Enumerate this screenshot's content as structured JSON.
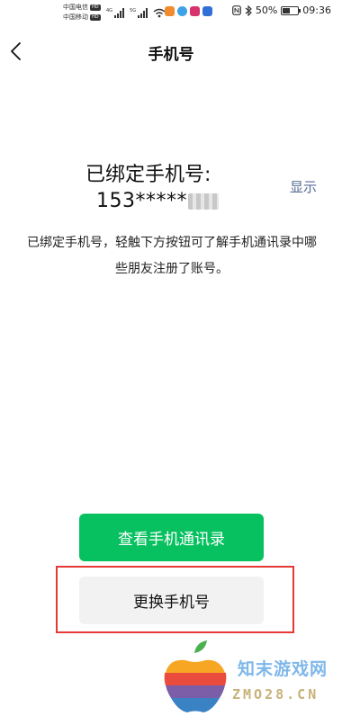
{
  "statusbar": {
    "carrier1": "中国电信",
    "carrier2": "中国移动",
    "hd": "HD",
    "sig1_label": "4G",
    "sig2_label": "5G",
    "battery_percent_text": "50%",
    "battery_level": 0.5,
    "time": "09:36",
    "app_icon_colors": [
      "#f28a2e",
      "#3ea0e6",
      "#d6336c",
      "#2f6fd6"
    ]
  },
  "header": {
    "title": "手机号"
  },
  "content": {
    "bound_label": "已绑定手机号:",
    "phone_masked": "153*****",
    "show_link": "显示",
    "description": "已绑定手机号，轻触下方按钮可了解手机通讯录中哪些朋友注册了账号。"
  },
  "buttons": {
    "view_contacts": "查看手机通讯录",
    "change_number": "更换手机号"
  },
  "watermark": {
    "text_cn": "知末游戏网",
    "text_en": "ZMO28.CN"
  },
  "colors": {
    "primary_green": "#07c160",
    "link_blue": "#576b95",
    "highlight_red": "#e53935"
  }
}
